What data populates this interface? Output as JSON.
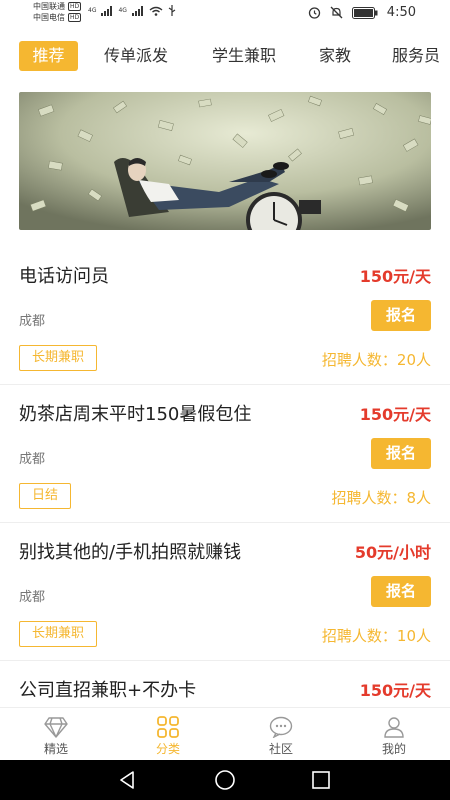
{
  "status_bar": {
    "carrier1": "中国联通",
    "carrier2": "中国电信",
    "hd": "HD",
    "net1": "4G",
    "net2": "4G",
    "time": "4:50",
    "icons": [
      "signal-icon",
      "wifi-icon",
      "usb-icon",
      "alarm-icon",
      "mute-icon",
      "battery-icon"
    ]
  },
  "tabs": [
    {
      "label": "推荐",
      "active": true
    },
    {
      "label": "传单派发",
      "active": false
    },
    {
      "label": "学生兼职",
      "active": false
    },
    {
      "label": "家教",
      "active": false
    },
    {
      "label": "服务员",
      "active": false
    }
  ],
  "banner": {
    "image": "money-rain-businessman-photo"
  },
  "jobs": [
    {
      "title": "电话访问员",
      "salary": "150元/天",
      "city": "成都",
      "apply_label": "报名",
      "tag": "长期兼职",
      "recruit": "招聘人数：20人"
    },
    {
      "title": "奶茶店周末平时150暑假包住",
      "salary": "150元/天",
      "city": "成都",
      "apply_label": "报名",
      "tag": "日结",
      "recruit": "招聘人数：8人"
    },
    {
      "title": "别找其他的/手机拍照就赚钱",
      "salary": "50元/小时",
      "city": "成都",
      "apply_label": "报名",
      "tag": "长期兼职",
      "recruit": "招聘人数：10人"
    },
    {
      "title": "公司直招兼职+不办卡",
      "salary": "150元/天"
    }
  ],
  "bottom_nav": [
    {
      "label": "精选",
      "icon": "diamond-icon",
      "active": false
    },
    {
      "label": "分类",
      "icon": "grid-icon",
      "active": true
    },
    {
      "label": "社区",
      "icon": "chat-bubble-icon",
      "active": false
    },
    {
      "label": "我的",
      "icon": "person-icon",
      "active": false
    }
  ],
  "system_nav": [
    "back-icon",
    "home-icon",
    "recents-icon"
  ],
  "colors": {
    "accent": "#f5b731",
    "salary": "#e43b2c"
  }
}
